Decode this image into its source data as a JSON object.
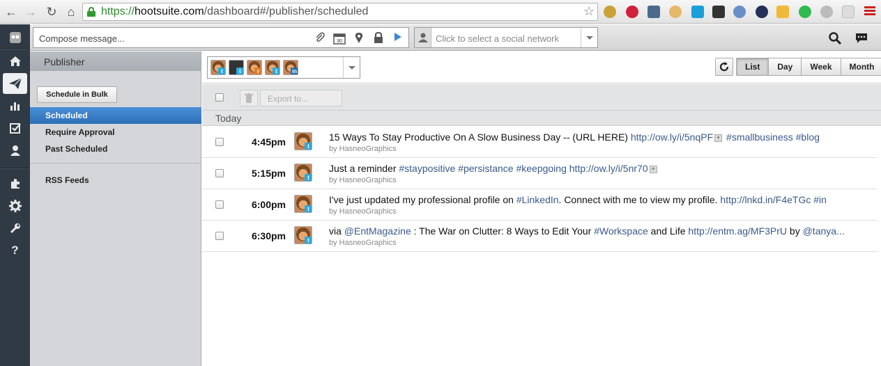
{
  "browser": {
    "url_protocol": "https://",
    "url_host": "hootsuite.com",
    "url_path": "/dashboard#/publisher/scheduled"
  },
  "compose": {
    "placeholder": "Compose message...",
    "network_placeholder": "Click to select a social network"
  },
  "publisher": {
    "title": "Publisher",
    "bulk_button": "Schedule in Bulk",
    "nav": [
      "Scheduled",
      "Require Approval",
      "Past Scheduled"
    ],
    "rss": "RSS Feeds"
  },
  "views": [
    "List",
    "Day",
    "Week",
    "Month"
  ],
  "active_view": "List",
  "export_placeholder": "Export to...",
  "day_label": "Today",
  "posts": [
    {
      "time": "4:45pm",
      "text": "15 Ways To Stay Productive On A Slow Business Day -- (URL HERE) ",
      "link": "http://ow.ly/i/5nqPF",
      "tags": " #smallbusiness #blog",
      "by": "by HasneoGraphics"
    },
    {
      "time": "5:15pm",
      "text": "Just a reminder ",
      "tags_pre": "#staypositive #persistance #keepgoing ",
      "link": "http://ow.ly/i/5nr70",
      "by": "by HasneoGraphics"
    },
    {
      "time": "6:00pm",
      "text": "I've just updated my professional profile on ",
      "tag1": "#LinkedIn",
      "text2": ". Connect with me to view my profile. ",
      "link": "http://lnkd.in/F4eTGc",
      "tags": " #in",
      "by": "by HasneoGraphics"
    },
    {
      "time": "6:30pm",
      "text": "via ",
      "mention": "@EntMagazine",
      "text2": " : The War on Clutter: 8 Ways to Edit Your ",
      "tag1": "#Workspace",
      "text3": " and Life ",
      "link": "http://entm.ag/MF3PrU",
      "text4": " by ",
      "mention2": "@tanya...",
      "by": "by HasneoGraphics"
    }
  ],
  "colors": {
    "accent": "#2d6fb8",
    "link": "#3a5a8c",
    "sidebar_dark": "#2f3a44",
    "twitter": "#2aa9e0",
    "linkedin": "#1f6fb2"
  }
}
